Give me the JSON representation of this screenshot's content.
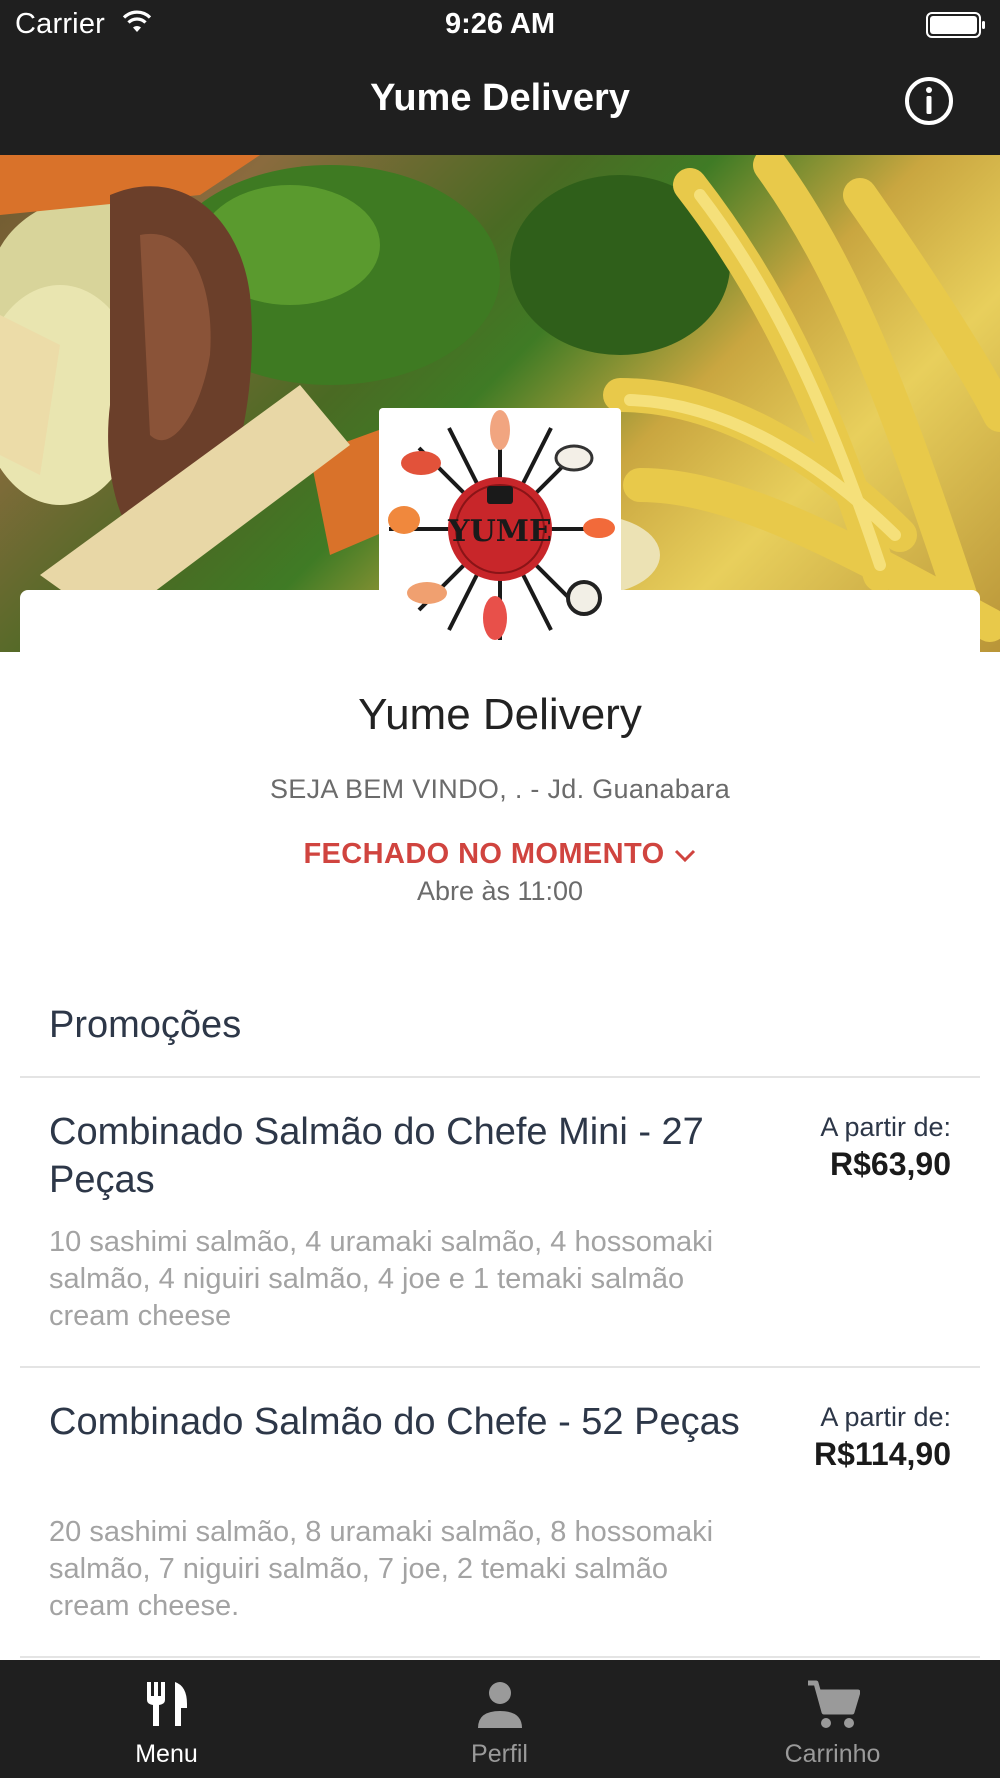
{
  "status_bar": {
    "carrier": "Carrier",
    "time": "9:26 AM",
    "wifi_icon": "wifi-icon",
    "battery_icon": "battery-icon"
  },
  "nav": {
    "title": "Yume Delivery",
    "info_icon": "info-icon"
  },
  "store": {
    "logo_label": "Yume Delivery logo",
    "name": "Yume Delivery",
    "greeting": "SEJA BEM VINDO, . - Jd. Guanabara",
    "status": "FECHADO NO MOMENTO",
    "opens": "Abre às 11:00",
    "status_color": "#d0443f"
  },
  "section": {
    "title": "Promoções"
  },
  "items": [
    {
      "name": "Combinado Salmão do Chefe Mini - 27 Peças",
      "description": "10 sashimi salmão, 4 uramaki salmão, 4 hossomaki salmão, 4 niguiri salmão, 4 joe e 1 temaki salmão cream cheese",
      "from_label": "A partir de:",
      "price": "R$63,90"
    },
    {
      "name": "Combinado Salmão do Chefe - 52 Peças",
      "description": "20 sashimi salmão, 8 uramaki salmão, 8 hossomaki salmão, 7 niguiri salmão, 7 joe, 2 temaki salmão cream cheese.",
      "from_label": "A partir de:",
      "price": "R$114,90"
    }
  ],
  "tabbar": {
    "tabs": [
      {
        "label": "Menu",
        "icon": "fork-knife-icon",
        "active": true
      },
      {
        "label": "Perfil",
        "icon": "person-icon",
        "active": false
      },
      {
        "label": "Carrinho",
        "icon": "cart-icon",
        "active": false
      }
    ],
    "active_color": "#ffffff",
    "inactive_color": "#9a9a9a"
  },
  "colors": {
    "bars": "#1f1f1f",
    "text_dark": "#2d3748",
    "text_muted": "#a3a3a3"
  }
}
